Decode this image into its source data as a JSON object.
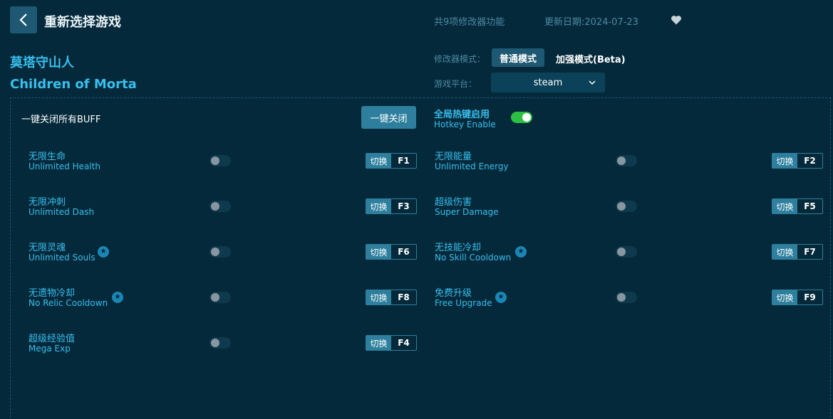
{
  "header": {
    "title": "重新选择游戏",
    "feature_count": "共9项修改器功能",
    "update_date": "更新日期:2024-07-23"
  },
  "game": {
    "name_cn": "莫塔守山人",
    "name_en": "Children of Morta"
  },
  "mode": {
    "label": "修改器模式：",
    "normal": "普通模式",
    "enhanced": "加强模式(Beta)"
  },
  "platform": {
    "label": "游戏平台：",
    "value": "steam"
  },
  "controls": {
    "close_all_label": "一键关闭所有BUFF",
    "close_all_button": "一键关闭",
    "hotkey_cn": "全局热键启用",
    "hotkey_en": "Hotkey Enable"
  },
  "switch_label": "切换",
  "cheats": [
    {
      "cn": "无限生命",
      "en": "Unlimited Health",
      "key": "F1",
      "star": false,
      "on": false
    },
    {
      "cn": "无限能量",
      "en": "Unlimited Energy",
      "key": "F2",
      "star": false,
      "on": false
    },
    {
      "cn": "无限冲刺",
      "en": "Unlimited Dash",
      "key": "F3",
      "star": false,
      "on": false
    },
    {
      "cn": "超级伤害",
      "en": "Super Damage",
      "key": "F5",
      "star": false,
      "on": false
    },
    {
      "cn": "无限灵魂",
      "en": "Unlimited Souls",
      "key": "F6",
      "star": true,
      "on": false
    },
    {
      "cn": "无技能冷却",
      "en": "No Skill Cooldown",
      "key": "F7",
      "star": true,
      "on": false
    },
    {
      "cn": "无遗物冷却",
      "en": "No Relic Cooldown",
      "key": "F8",
      "star": true,
      "on": false
    },
    {
      "cn": "免费升级",
      "en": "Free Upgrade",
      "key": "F9",
      "star": true,
      "on": false
    },
    {
      "cn": "超级经验值",
      "en": "Mega Exp",
      "key": "F4",
      "star": false,
      "on": false
    }
  ],
  "icons": {
    "back": "chevron-left-icon",
    "favorite": "heart-icon",
    "dropdown": "chevron-down-icon",
    "premium": "star-icon"
  },
  "colors": {
    "background": "#04293a",
    "accent": "#38bfee",
    "button": "#2e7f9d",
    "toggle_on": "#2dbf43"
  }
}
